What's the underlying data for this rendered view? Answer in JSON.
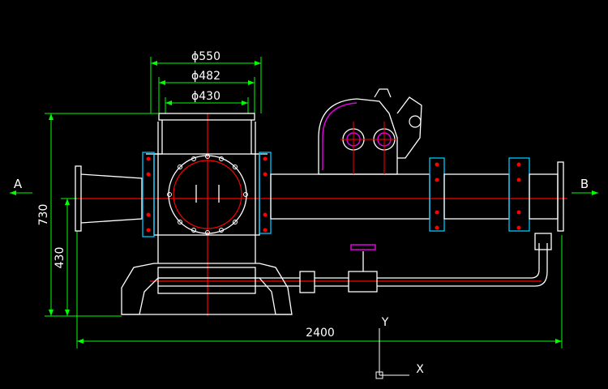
{
  "colors": {
    "background": "#000000",
    "outline": "#ffffff",
    "dimension": "#00ff00",
    "centerline": "#ff0000",
    "flange": "#00c8ff",
    "accent": "#e000e0",
    "bolt": "#ff0000"
  },
  "dimensions": {
    "d550": "ϕ550",
    "d482": "ϕ482",
    "d430": "ϕ430",
    "height_total": "730",
    "height_axis": "430",
    "length_total": "2400"
  },
  "section_labels": {
    "left": "A",
    "right": "B"
  },
  "axes": {
    "x": "X",
    "y": "Y"
  }
}
